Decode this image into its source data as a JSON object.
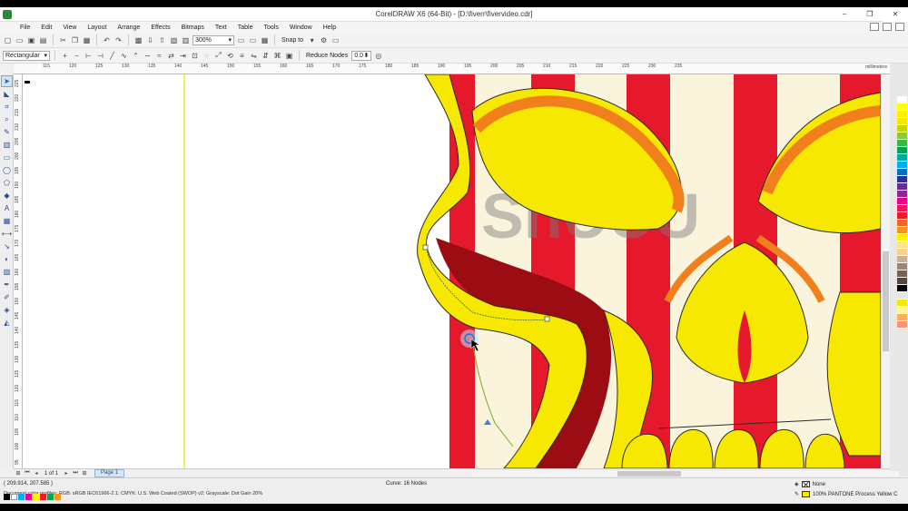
{
  "window": {
    "title": "CorelDRAW X6 (64-Bit) - [D:\\fiverr\\fivervideo.cdr]",
    "min_glyph": "–",
    "max_glyph": "❐",
    "close_glyph": "✕"
  },
  "menu": [
    "File",
    "Edit",
    "View",
    "Layout",
    "Arrange",
    "Effects",
    "Bitmaps",
    "Text",
    "Table",
    "Tools",
    "Window",
    "Help"
  ],
  "toolbar1": {
    "zoom_value": "300%",
    "snap_to_label": "Snap to"
  },
  "toolbar2": {
    "mode_value": "Rectangular",
    "reduce_nodes_label": "Reduce Nodes",
    "reduce_nodes_value": "0.0"
  },
  "ruler": {
    "units": "millimeters",
    "h_labels": [
      "115",
      "120",
      "125",
      "130",
      "135",
      "140",
      "145",
      "150",
      "155",
      "160",
      "165",
      "170",
      "175",
      "180",
      "185",
      "190",
      "195",
      "200",
      "205",
      "210",
      "215",
      "220",
      "225",
      "230",
      "235"
    ],
    "v_labels": [
      "225",
      "220",
      "215",
      "210",
      "205",
      "200",
      "195",
      "190",
      "185",
      "180",
      "175",
      "170",
      "165",
      "160",
      "155",
      "150",
      "145",
      "140",
      "135",
      "130",
      "125",
      "120",
      "115",
      "110",
      "105",
      "100",
      "95"
    ]
  },
  "page_nav": {
    "counter": "1 of 1",
    "page_tab": "Page 1"
  },
  "status": {
    "coords": "( 209.914, 207.585 )",
    "curve_info": "Curve: 16 Nodes",
    "profile": "Document color profiles: RGB: sRGB IEC61966-2.1; CMYK: U.S. Web Coated (SWOP) v2; Grayscale: Dot Gain 20%",
    "fill_none_label": "None",
    "fill_color_label": "100% PANTONE Process Yellow C"
  },
  "colors": {
    "accent_yellow": "#f6e800",
    "stripe_red": "#e5192b",
    "dark_red": "#9b0d12",
    "orange": "#f07f1c",
    "cream": "#faf4dc"
  },
  "palette": [
    "#ffffff",
    "#ffff00",
    "#ffef00",
    "#f6e800",
    "#c8d400",
    "#8dc63f",
    "#39b54a",
    "#00a651",
    "#00a99d",
    "#00aeef",
    "#0072bc",
    "#2e3192",
    "#662d91",
    "#92278f",
    "#ec008c",
    "#ed145b",
    "#ed1c24",
    "#f26522",
    "#f7941d",
    "#fff200",
    "#fbe58a",
    "#f9d38d",
    "#c7b299",
    "#998675",
    "#736357",
    "#534741",
    "#000000",
    "#e6e6e6",
    "#f6e800",
    "#fff799",
    "#fbaf5d",
    "#f69679"
  ],
  "doc_palette": [
    "#000000",
    "#ffffff",
    "#00aeef",
    "#ec008c",
    "#fff200",
    "#ed1c24",
    "#00a651",
    "#f7941d"
  ]
}
